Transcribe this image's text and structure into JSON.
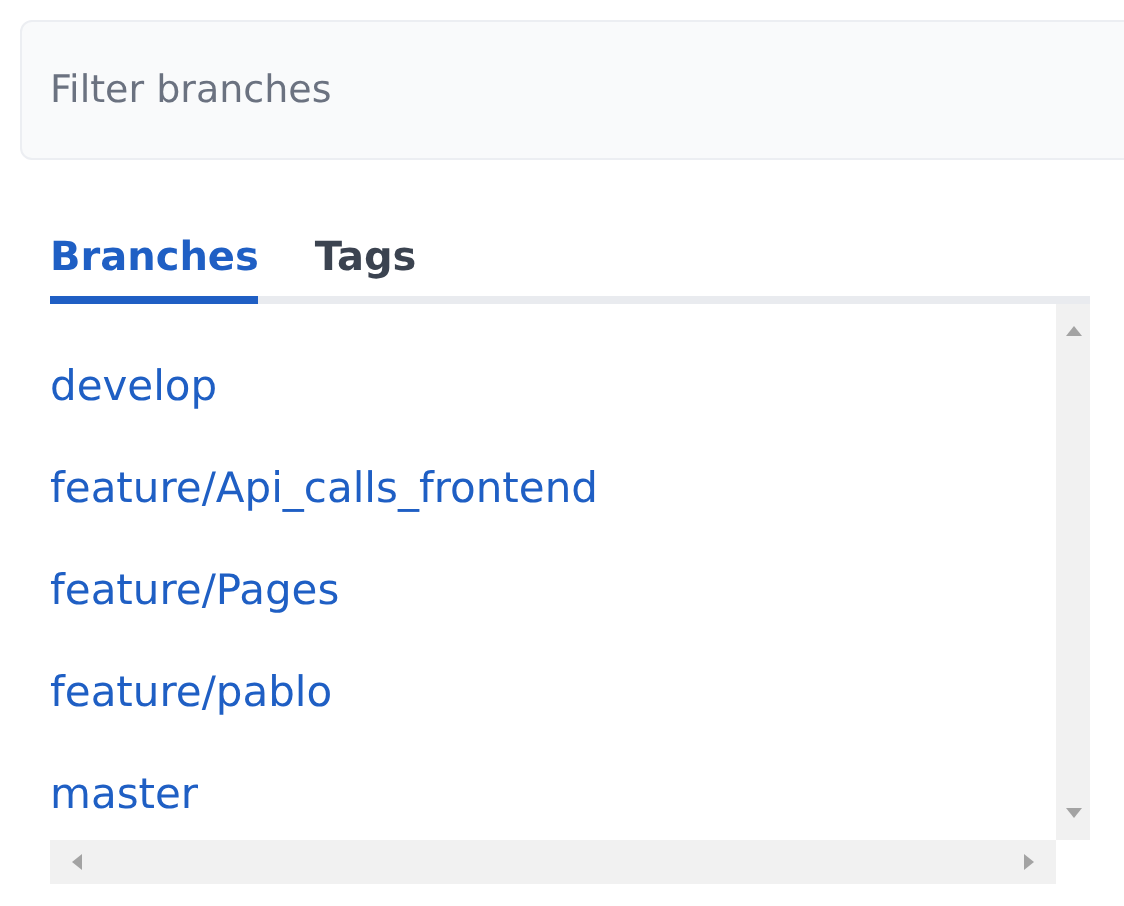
{
  "filter": {
    "placeholder": "Filter branches"
  },
  "tabs": [
    {
      "label": "Branches",
      "selected": true
    },
    {
      "label": "Tags",
      "selected": false
    }
  ],
  "branches": [
    "develop",
    "feature/Api_calls_frontend",
    "feature/Pages",
    "feature/pablo",
    "master"
  ]
}
